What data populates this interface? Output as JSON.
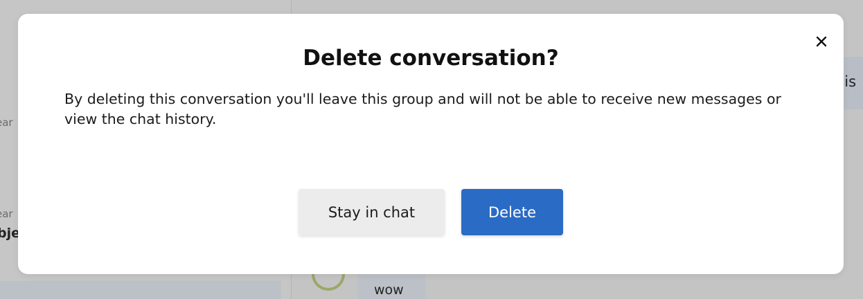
{
  "background": {
    "left_panel": {
      "snippet_1": "ear",
      "snippet_2": "ear",
      "bold_snippet": "bje"
    },
    "right_panel": {
      "bubble_snippet": "his",
      "message_text": "wow"
    }
  },
  "dialog": {
    "title": "Delete conversation?",
    "body": "By deleting this conversation you'll leave this group and will not be able to receive new messages or view the chat history.",
    "close_icon": "close-icon",
    "secondary_button_label": "Stay in chat",
    "primary_button_label": "Delete"
  },
  "colors": {
    "overlay": "#c4c4c4",
    "primary_button": "#2a6bc5",
    "secondary_button": "#ececec"
  }
}
